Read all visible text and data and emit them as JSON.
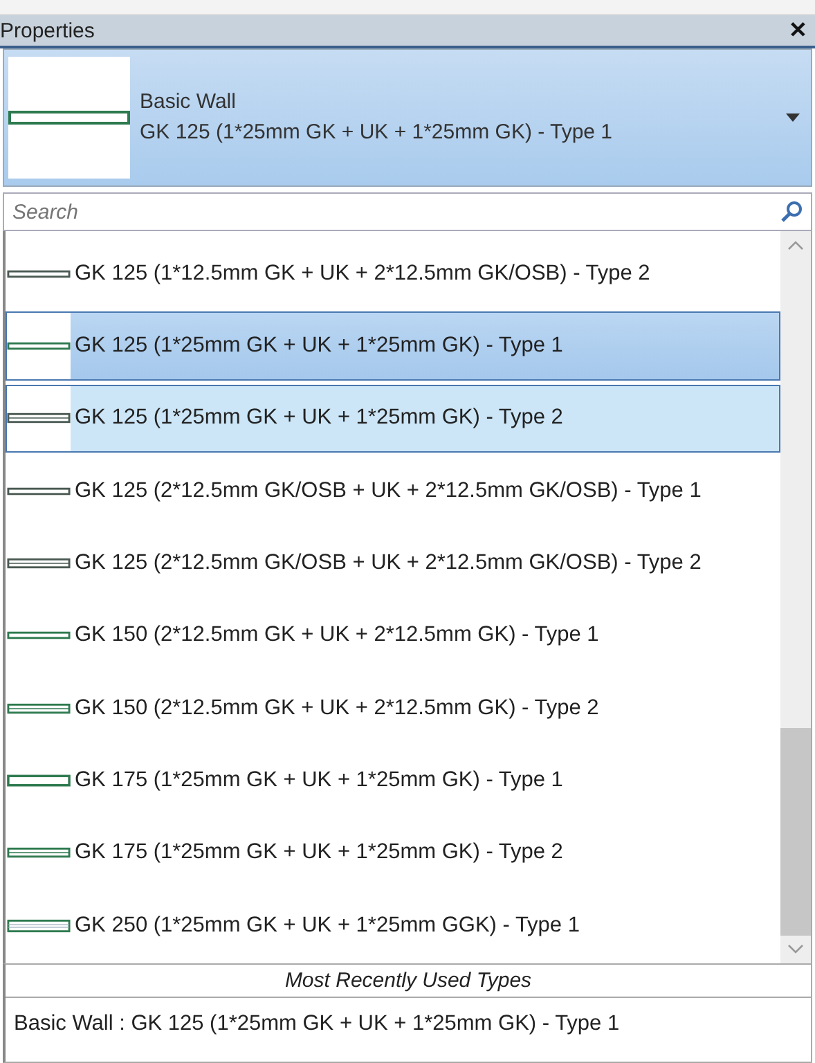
{
  "panel": {
    "title": "Properties",
    "close": "✕"
  },
  "type_selector": {
    "family": "Basic Wall",
    "type": "GK 125 (1*25mm GK + UK + 1*25mm GK) - Type 1",
    "expanded": true
  },
  "search": {
    "placeholder": "Search"
  },
  "types": [
    {
      "label": "GK 125 (1*12.5mm GK + UK + 2*12.5mm GK/OSB) - Type 2",
      "kind": "thin",
      "selected": false,
      "hovered": false
    },
    {
      "label": "GK 125 (1*25mm GK + UK + 1*25mm GK) - Type 1",
      "kind": "thin",
      "selected": true,
      "hovered": false
    },
    {
      "label": "GK 125 (1*25mm GK + UK + 1*25mm GK) - Type 2",
      "kind": "double",
      "selected": false,
      "hovered": true
    },
    {
      "label": "GK 125 (2*12.5mm GK/OSB + UK + 2*12.5mm GK/OSB) - Type 1",
      "kind": "thin",
      "selected": false,
      "hovered": false
    },
    {
      "label": "GK 125 (2*12.5mm GK/OSB + UK + 2*12.5mm GK/OSB) - Type 2",
      "kind": "double",
      "selected": false,
      "hovered": false
    },
    {
      "label": "GK 150 (2*12.5mm GK + UK + 2*12.5mm GK) - Type 1",
      "kind": "thin",
      "selected": false,
      "hovered": false
    },
    {
      "label": "GK 150 (2*12.5mm GK + UK + 2*12.5mm GK) - Type 2",
      "kind": "double",
      "selected": false,
      "hovered": false
    },
    {
      "label": "GK 175 (1*25mm GK + UK + 1*25mm GK) - Type 1",
      "kind": "wide",
      "selected": false,
      "hovered": false
    },
    {
      "label": "GK 175 (1*25mm GK + UK + 1*25mm GK) - Type 2",
      "kind": "double",
      "selected": false,
      "hovered": false
    },
    {
      "label": "GK 250 (1*25mm GK + UK + 1*25mm GGK) - Type 1",
      "kind": "layered",
      "selected": false,
      "hovered": false
    }
  ],
  "recent": {
    "heading": "Most Recently Used Types",
    "items": [
      "Basic Wall : GK 125 (1*25mm GK + UK + 1*25mm GK) - Type 1"
    ]
  }
}
